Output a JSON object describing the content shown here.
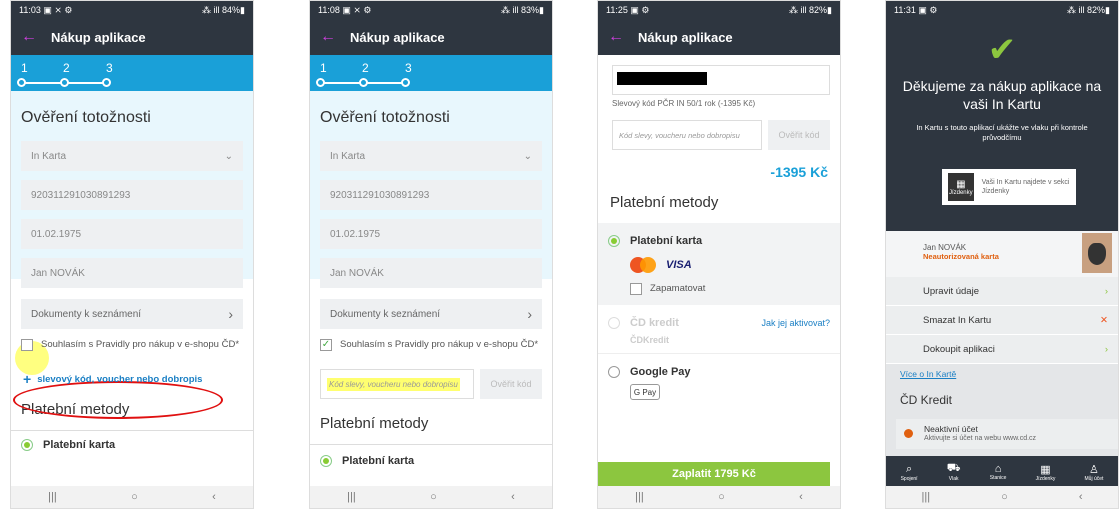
{
  "common": {
    "title": "Nákup aplikace",
    "back": "←",
    "steps": [
      "1",
      "2",
      "3"
    ],
    "nav": [
      "|||",
      "○",
      "‹"
    ]
  },
  "p1": {
    "time": "11:03 ▣ ⨯ ⚙",
    "signal": "⁂ ill 84%▮",
    "heading": "Ověření totožnosti",
    "card": "In Karta",
    "number": "920311291030891293",
    "date": "01.02.1975",
    "name": "Jan NOVÁK",
    "docs": "Dokumenty k seznámení",
    "agree": "Souhlasím s Pravidly pro nákup v e-shopu ČD*",
    "voucher_plus": "+",
    "voucher": "slevový kód, voucher nebo dobropis",
    "methods": "Platební metody",
    "card_pay": "Platební karta"
  },
  "p2": {
    "time": "11:08 ▣ ⨯ ⚙",
    "signal": "⁂ ill 83%▮",
    "heading": "Ověření totožnosti",
    "card": "In Karta",
    "number": "920311291030891293",
    "date": "01.02.1975",
    "name": "Jan NOVÁK",
    "docs": "Dokumenty k seznámení",
    "agree": "Souhlasím s Pravidly pro nákup v e-shopu ČD*",
    "code_placeholder": "Kód slevy, voucheru nebo dobropisu",
    "verify": "Ověřit kód",
    "methods": "Platební metody",
    "card_pay": "Platební karta"
  },
  "p3": {
    "time": "11:25 ▣ ⚙",
    "signal": "⁂ ill 82%▮",
    "discount_label": "Slevový kód PČR IN 50/1 rok (-1395 Kč)",
    "code_placeholder": "Kód slevy, voucheru nebo dobropisu",
    "verify": "Ověřit kód",
    "amount": "-1395 Kč",
    "methods": "Platební metody",
    "card_pay": "Platební karta",
    "visa": "VISA",
    "remember": "Zapamatovat",
    "cd_credit": "ČD kredit",
    "activate": "Jak jej aktivovat?",
    "cd_credit_logo": "ČDKredit",
    "google_pay": "Google Pay",
    "gpay": "G Pay",
    "pay_button": "Zaplatit 1795 Kč"
  },
  "p4": {
    "time": "11:31 ▣ ⚙",
    "signal": "⁂ ill 82%▮",
    "thanks": "Děkujeme za nákup aplikace na vaši In Kartu",
    "info": "In Kartu s touto aplikací ukážte ve vlaku při kontrole průvodčímu",
    "tooltip": "Vaši In Kartu najdete v sekci Jízdenky",
    "tooltip_icon": "Jízdenky",
    "user": "Jan NOVÁK",
    "unauthorized": "Neautorizovaná karta",
    "edit": "Upravit údaje",
    "delete": "Smazat In Kartu",
    "buy": "Dokoupit aplikaci",
    "more": "Více o In Kartě",
    "credit_title": "ČD Kredit",
    "inactive": "Neaktivní účet",
    "activate_web": "Aktivujte si účet na webu www.cd.cz",
    "tabs": [
      "Spojení",
      "Vlak",
      "Stanice",
      "Jízdenky",
      "Můj účet"
    ],
    "tab_icons": [
      "⌕",
      "⛟",
      "⌂",
      "▦",
      "♙"
    ]
  },
  "colors": {
    "accent": "#1aa0d8",
    "dark": "#2e3640",
    "green": "#8cc63f",
    "blue_text": "#1a7fc4"
  }
}
